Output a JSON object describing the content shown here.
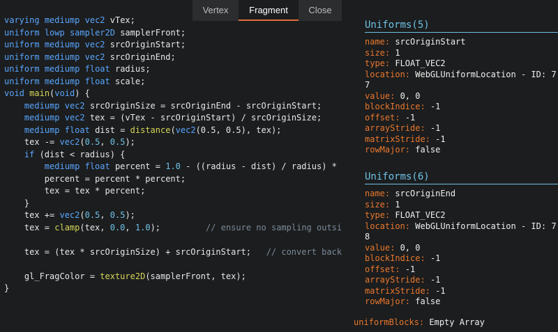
{
  "tabs": [
    "Vertex",
    "Fragment",
    "Close"
  ],
  "code_lines": [
    [
      [
        "kw",
        "varying"
      ],
      [
        "tx",
        " "
      ],
      [
        "kw",
        "mediump"
      ],
      [
        "tx",
        " "
      ],
      [
        "kw",
        "vec2"
      ],
      [
        "tx",
        " vTex;"
      ]
    ],
    [
      [
        "kw",
        "uniform"
      ],
      [
        "tx",
        " "
      ],
      [
        "kw",
        "lowp"
      ],
      [
        "tx",
        " "
      ],
      [
        "kw",
        "sampler2D"
      ],
      [
        "tx",
        " samplerFront;"
      ]
    ],
    [
      [
        "kw",
        "uniform"
      ],
      [
        "tx",
        " "
      ],
      [
        "kw",
        "mediump"
      ],
      [
        "tx",
        " "
      ],
      [
        "kw",
        "vec2"
      ],
      [
        "tx",
        " srcOriginStart;"
      ]
    ],
    [
      [
        "kw",
        "uniform"
      ],
      [
        "tx",
        " "
      ],
      [
        "kw",
        "mediump"
      ],
      [
        "tx",
        " "
      ],
      [
        "kw",
        "vec2"
      ],
      [
        "tx",
        " srcOriginEnd;"
      ]
    ],
    [
      [
        "kw",
        "uniform"
      ],
      [
        "tx",
        " "
      ],
      [
        "kw",
        "mediump"
      ],
      [
        "tx",
        " "
      ],
      [
        "kw",
        "float"
      ],
      [
        "tx",
        " radius;"
      ]
    ],
    [
      [
        "kw",
        "uniform"
      ],
      [
        "tx",
        " "
      ],
      [
        "kw",
        "mediump"
      ],
      [
        "tx",
        " "
      ],
      [
        "kw",
        "float"
      ],
      [
        "tx",
        " scale;"
      ]
    ],
    [
      [
        "kw",
        "void"
      ],
      [
        "tx",
        " "
      ],
      [
        "fn",
        "main"
      ],
      [
        "tx",
        "("
      ],
      [
        "kw",
        "void"
      ],
      [
        "tx",
        ") {"
      ]
    ],
    [
      [
        "tx",
        "    "
      ],
      [
        "kw",
        "mediump"
      ],
      [
        "tx",
        " "
      ],
      [
        "kw",
        "vec2"
      ],
      [
        "tx",
        " srcOriginSize = srcOriginEnd - srcOriginStart;"
      ]
    ],
    [
      [
        "tx",
        "    "
      ],
      [
        "kw",
        "mediump"
      ],
      [
        "tx",
        " "
      ],
      [
        "kw",
        "vec2"
      ],
      [
        "tx",
        " tex = (vTex - srcOriginStart) / srcOriginSize;"
      ]
    ],
    [
      [
        "tx",
        "    "
      ],
      [
        "kw",
        "mediump"
      ],
      [
        "tx",
        " "
      ],
      [
        "kw",
        "float"
      ],
      [
        "tx",
        " dist = "
      ],
      [
        "fn",
        "distance"
      ],
      [
        "tx",
        "("
      ],
      [
        "kw",
        "vec2"
      ],
      [
        "tx",
        "(0.5, 0.5), tex);"
      ]
    ],
    [
      [
        "tx",
        "    tex -= "
      ],
      [
        "kw",
        "vec2"
      ],
      [
        "tx",
        "("
      ],
      [
        "num",
        "0.5"
      ],
      [
        "tx",
        ", "
      ],
      [
        "num",
        "0.5"
      ],
      [
        "tx",
        ");"
      ]
    ],
    [
      [
        "tx",
        "    "
      ],
      [
        "kw",
        "if"
      ],
      [
        "tx",
        " (dist < radius) {"
      ]
    ],
    [
      [
        "tx",
        "        "
      ],
      [
        "kw",
        "mediump"
      ],
      [
        "tx",
        " "
      ],
      [
        "kw",
        "float"
      ],
      [
        "tx",
        " percent = "
      ],
      [
        "num",
        "1.0"
      ],
      [
        "tx",
        " - ((radius - dist) / radius) * scale"
      ]
    ],
    [
      [
        "tx",
        "        percent = percent * percent;"
      ]
    ],
    [
      [
        "tx",
        "        tex = tex * percent;"
      ]
    ],
    [
      [
        "tx",
        "    }"
      ]
    ],
    [
      [
        "tx",
        "    tex += "
      ],
      [
        "kw",
        "vec2"
      ],
      [
        "tx",
        "("
      ],
      [
        "num",
        "0.5"
      ],
      [
        "tx",
        ", "
      ],
      [
        "num",
        "0.5"
      ],
      [
        "tx",
        ");"
      ]
    ],
    [
      [
        "tx",
        "    tex = "
      ],
      [
        "fn",
        "clamp"
      ],
      [
        "tx",
        "(tex, "
      ],
      [
        "num",
        "0.0"
      ],
      [
        "tx",
        ", "
      ],
      [
        "num",
        "1.0"
      ],
      [
        "tx",
        ");         "
      ],
      [
        "cm",
        "// ensure no sampling outside src area"
      ]
    ],
    [
      [
        "tx",
        ""
      ]
    ],
    [
      [
        "tx",
        "    tex = (tex * srcOriginSize) + srcOriginStart;   "
      ],
      [
        "cm",
        "// convert back relative"
      ]
    ],
    [
      [
        "tx",
        ""
      ]
    ],
    [
      [
        "tx",
        "    gl_FragColor = "
      ],
      [
        "fn",
        "texture2D"
      ],
      [
        "tx",
        "(samplerFront, tex);"
      ]
    ],
    [
      [
        "tx",
        "}"
      ]
    ]
  ],
  "uniforms": [
    {
      "header": "Uniforms(5)",
      "rows": [
        [
          "name",
          "srcOriginStart"
        ],
        [
          "size",
          "1"
        ],
        [
          "type",
          "FLOAT_VEC2"
        ],
        [
          "location",
          "WebGLUniformLocation - ID: 77"
        ],
        [
          "value",
          "0, 0"
        ],
        [
          "blockIndice",
          "-1"
        ],
        [
          "offset",
          "-1"
        ],
        [
          "arrayStride",
          "-1"
        ],
        [
          "matrixStride",
          "-1"
        ],
        [
          "rowMajor",
          "false"
        ]
      ]
    },
    {
      "header": "Uniforms(6)",
      "rows": [
        [
          "name",
          "srcOriginEnd"
        ],
        [
          "size",
          "1"
        ],
        [
          "type",
          "FLOAT_VEC2"
        ],
        [
          "location",
          "WebGLUniformLocation - ID: 78"
        ],
        [
          "value",
          "0, 0"
        ],
        [
          "blockIndice",
          "-1"
        ],
        [
          "offset",
          "-1"
        ],
        [
          "arrayStride",
          "-1"
        ],
        [
          "matrixStride",
          "-1"
        ],
        [
          "rowMajor",
          "false"
        ]
      ]
    }
  ],
  "uniform_blocks": {
    "key": "uniformBlocks",
    "value": "Empty Array"
  },
  "colors": {
    "keyword": "#58a6ff",
    "function": "#d6d65a",
    "number": "#6ec3e8",
    "comment": "#7b8a99",
    "key": "#e8782e",
    "header": "#6ec3e8",
    "tab_active_border": "#e0703a"
  }
}
